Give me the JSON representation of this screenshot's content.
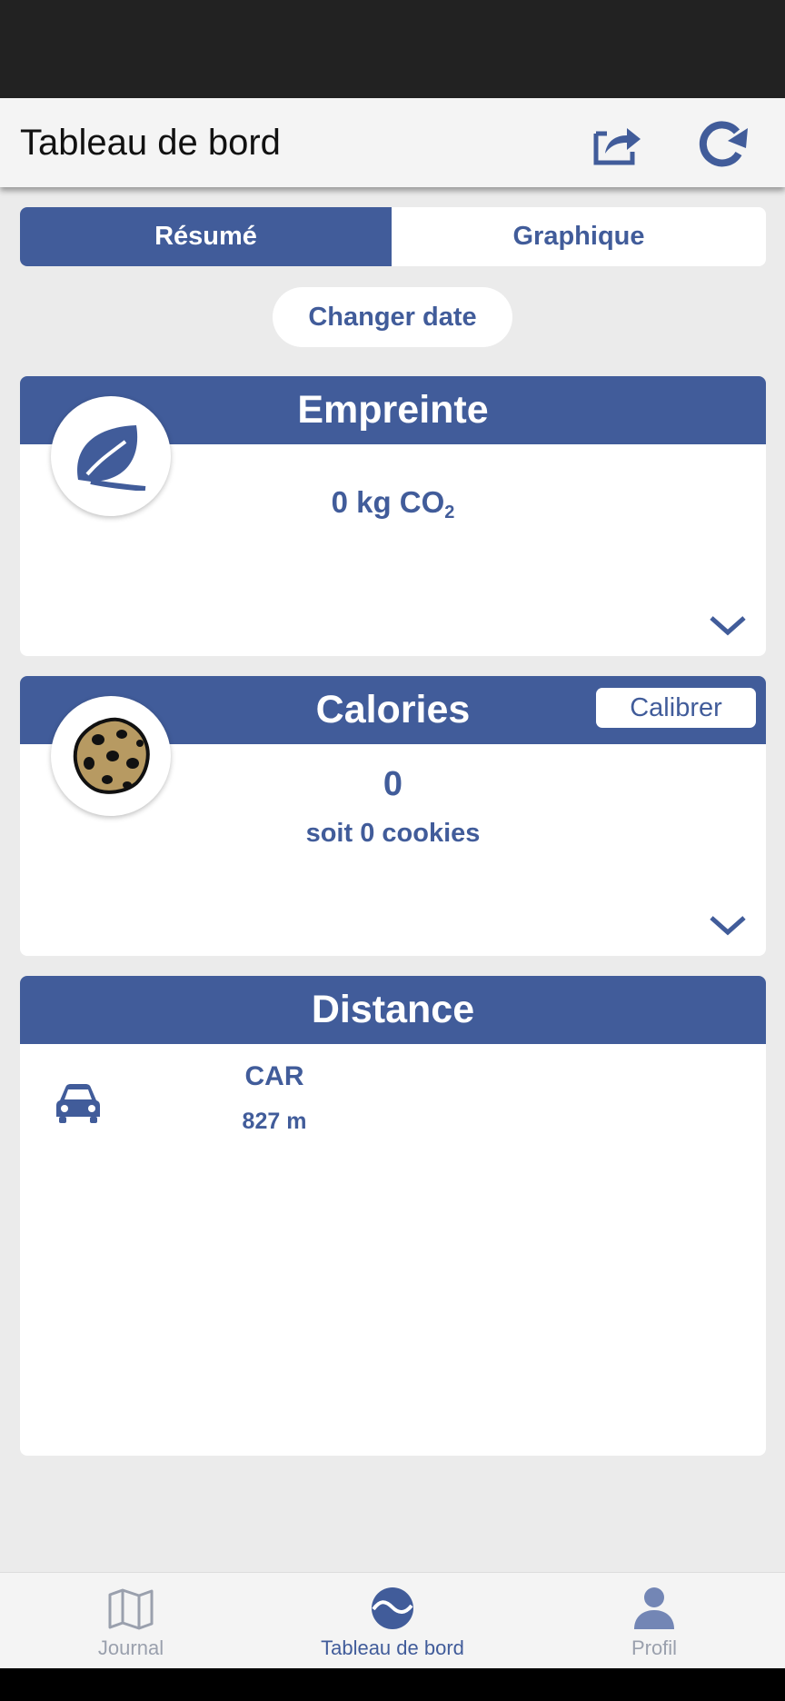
{
  "header": {
    "title": "Tableau de bord",
    "share_icon": "share-icon",
    "refresh_icon": "refresh-icon"
  },
  "tabs": [
    {
      "label": "Résumé",
      "active": true
    },
    {
      "label": "Graphique",
      "active": false
    }
  ],
  "change_date_label": "Changer date",
  "footprint": {
    "title": "Empreinte",
    "value": "0 kg CO",
    "value_subscript": "2",
    "icon": "leaf-icon"
  },
  "calories": {
    "title": "Calories",
    "calibrate_label": "Calibrer",
    "value": "0",
    "subtext": "soit 0 cookies",
    "icon": "cookie-icon"
  },
  "distance": {
    "title": "Distance",
    "modes": [
      {
        "mode": "CAR",
        "value": "827 m",
        "icon": "car-icon"
      }
    ]
  },
  "nav": [
    {
      "label": "Journal",
      "icon": "map-icon",
      "active": false
    },
    {
      "label": "Tableau de bord",
      "icon": "dashboard-icon",
      "active": true
    },
    {
      "label": "Profil",
      "icon": "user-icon",
      "active": false
    }
  ],
  "colors": {
    "primary": "#415c9a",
    "background": "#ebebeb",
    "inactive": "#9aa0ad"
  }
}
